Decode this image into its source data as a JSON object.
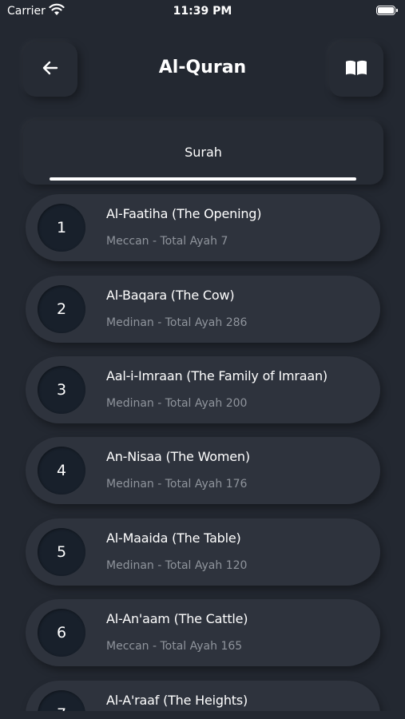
{
  "status_bar": {
    "carrier": "Carrier",
    "time": "11:39 PM"
  },
  "header": {
    "title": "Al-Quran",
    "back_icon": "arrow-left",
    "book_icon": "open-book"
  },
  "tabs": [
    {
      "label": "Surah",
      "active": true
    }
  ],
  "surahs": [
    {
      "number": "1",
      "name": "Al-Faatiha (The Opening)",
      "meta": "Meccan - Total Ayah 7"
    },
    {
      "number": "2",
      "name": "Al-Baqara (The Cow)",
      "meta": "Medinan - Total Ayah 286"
    },
    {
      "number": "3",
      "name": "Aal-i-Imraan (The Family of Imraan)",
      "meta": "Medinan - Total Ayah 200"
    },
    {
      "number": "4",
      "name": "An-Nisaa (The Women)",
      "meta": "Medinan - Total Ayah 176"
    },
    {
      "number": "5",
      "name": "Al-Maaida (The Table)",
      "meta": "Medinan - Total Ayah 120"
    },
    {
      "number": "6",
      "name": "Al-An'aam (The Cattle)",
      "meta": "Meccan - Total Ayah 165"
    },
    {
      "number": "7",
      "name": "Al-A'raaf (The Heights)",
      "meta": ""
    }
  ]
}
